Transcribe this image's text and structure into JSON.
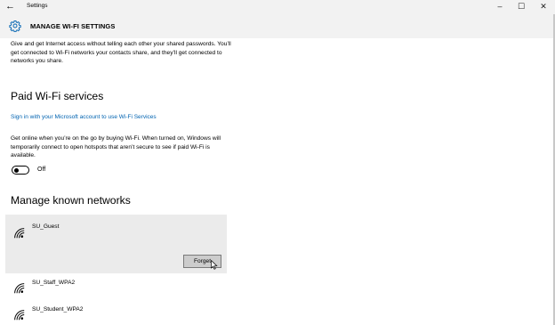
{
  "window": {
    "app_title": "Settings",
    "back_glyph": "←",
    "minimize_glyph": "–",
    "maximize_glyph": "☐",
    "close_glyph": "✕"
  },
  "header": {
    "title": "MANAGE WI-FI SETTINGS",
    "icon": "gear-icon"
  },
  "intro_text": "Give and get Internet access without telling each other your shared passwords. You’ll get connected to Wi-Fi networks your contacts share, and they’ll get connected to networks you share.",
  "paid": {
    "title": "Paid Wi-Fi services",
    "link": "Sign in with your Microsoft account to use Wi-Fi Services",
    "description": "Get online when you’re on the go by buying Wi-Fi. When turned on, Windows will temporarily connect to open hotspots that aren’t secure to see if paid Wi-Fi is available.",
    "toggle_state": "Off"
  },
  "known": {
    "title": "Manage known networks",
    "networks": [
      {
        "name": "SU_Guest",
        "selected": true
      },
      {
        "name": "SU_Staff_WPA2",
        "selected": false
      },
      {
        "name": "SU_Student_WPA2",
        "selected": false
      }
    ],
    "forget_label": "Forget"
  },
  "colors": {
    "link": "#0063b1",
    "header_bg": "#f2f2f2",
    "selected_bg": "#ebebeb",
    "button_bg": "#cccccc"
  }
}
